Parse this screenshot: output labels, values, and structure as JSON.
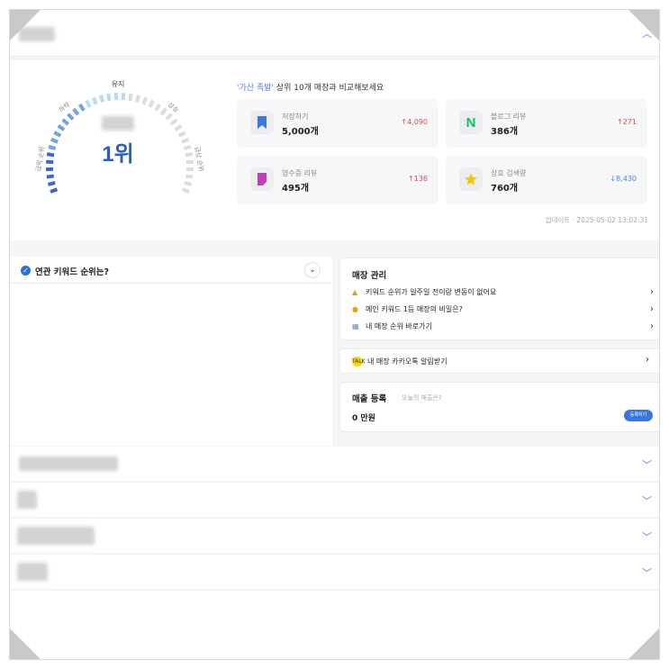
{
  "header": {
    "collapse_icon": "chevron-up"
  },
  "rank": {
    "gauge_labels": {
      "maintain": "유지",
      "down": "하락",
      "up": "상승",
      "sharp_down": "급락 순위",
      "sharp_up": "급상 순위"
    },
    "rank_value": "1위",
    "compare_title_highlight": "'가산 족발'",
    "compare_title_rest": " 상위 10개 매장과 비교해보세요",
    "stats": [
      {
        "label": "저장하기",
        "value": "5,000개",
        "change": "↑4,090",
        "dir": "up",
        "icon": "bookmark-icon",
        "color": "#3a76e0"
      },
      {
        "label": "블로그 리뷰",
        "value": "386개",
        "change": "↑271",
        "dir": "up",
        "icon": "naver-n-icon",
        "color": "#03c75a"
      },
      {
        "label": "영수증 리뷰",
        "value": "495개",
        "change": "↑136",
        "dir": "up",
        "icon": "receipt-icon",
        "color": "#c03fb8"
      },
      {
        "label": "상호 검색량",
        "value": "760개",
        "change": "↓8,430",
        "dir": "down",
        "icon": "star-icon",
        "color": "#f5c400"
      }
    ],
    "updated": "업데이트 · 2025-05-02 13:02:31"
  },
  "keywords": {
    "title": "연관 키워드 순위는?"
  },
  "management": {
    "title": "매장 관리",
    "items": [
      {
        "label": "키워드 순위가 일주일 전이랑 변동이 없어요",
        "icon": "chart-icon"
      },
      {
        "label": "메인 키워드 1등 매장의 비밀은?",
        "icon": "coin-icon"
      },
      {
        "label": "내 매장 순위 바로가기",
        "icon": "graph-icon"
      }
    ]
  },
  "kakao": {
    "label": "내 매장 카카오톡 알림받기",
    "icon_text": "TALK"
  },
  "sales": {
    "title": "매출 등록",
    "sub": "오늘의 매출은?",
    "amount": "0 만원",
    "button": "등록하기"
  },
  "colors": {
    "accent": "#3a76e0",
    "up": "#e04a4a",
    "down": "#4a82e8"
  }
}
